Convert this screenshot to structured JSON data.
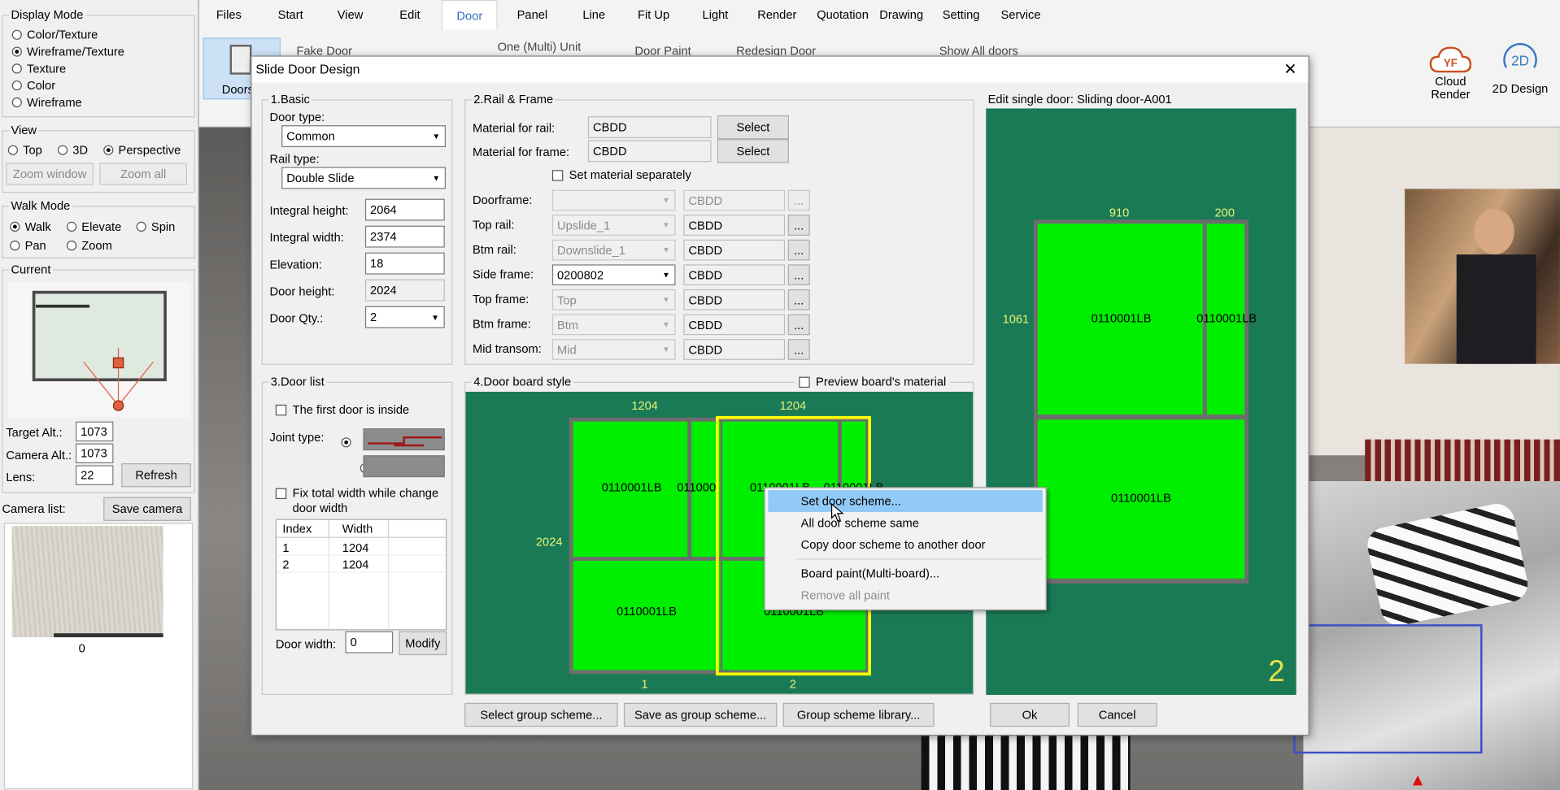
{
  "left_panel": {
    "display_mode": {
      "title": "Display Mode",
      "options": [
        "Color/Texture",
        "Wireframe/Texture",
        "Texture",
        "Color",
        "Wireframe"
      ],
      "selected": "Wireframe/Texture"
    },
    "view": {
      "title": "View",
      "options": [
        "Top",
        "3D",
        "Perspective"
      ],
      "selected": "Perspective",
      "zoom_window": "Zoom window",
      "zoom_all": "Zoom all"
    },
    "walk_mode": {
      "title": "Walk Mode",
      "options": [
        "Walk",
        "Elevate",
        "Spin",
        "Pan",
        "Zoom"
      ],
      "selected": "Walk"
    },
    "current": {
      "title": "Current",
      "target_alt_label": "Target Alt.:",
      "target_alt": "1073",
      "camera_alt_label": "Camera Alt.:",
      "camera_alt": "1073",
      "lens_label": "Lens:",
      "lens": "22",
      "refresh": "Refresh"
    },
    "camera_list": {
      "label": "Camera list:",
      "save_camera": "Save camera",
      "thumb_caption": "0"
    }
  },
  "ribbon": {
    "menus": [
      "Files",
      "Start",
      "View",
      "Edit",
      "Door",
      "Panel",
      "Line",
      "Fit Up",
      "Light",
      "Render",
      "Quotation",
      "Drawing",
      "Setting",
      "Service"
    ],
    "active_menu": "Door",
    "tools": {
      "doors": "Doors",
      "fake_door": "Fake Door",
      "one_multi_unit": "One (Multi) Unit",
      "door_paint": "Door Paint",
      "redesign_door": "Redesign Door",
      "show_all_doors": "Show All doors"
    },
    "cloud_render": {
      "line1": "Cloud",
      "line2": "Render",
      "logo_text": "YF"
    },
    "design_2d": {
      "label": "2D Design",
      "logo_text": "2D"
    }
  },
  "dialog": {
    "title": "Slide Door Design",
    "close_glyph": "✕",
    "basic": {
      "title": "1.Basic",
      "door_type_label": "Door type:",
      "door_type": "Common",
      "rail_type_label": "Rail type:",
      "rail_type": "Double Slide",
      "integral_height_label": "Integral height:",
      "integral_height": "2064",
      "integral_width_label": "Integral width:",
      "integral_width": "2374",
      "elevation_label": "Elevation:",
      "elevation": "18",
      "door_height_label": "Door height:",
      "door_height": "2024",
      "door_qty_label": "Door Qty.:",
      "door_qty": "2"
    },
    "rail_frame": {
      "title": "2.Rail & Frame",
      "material_rail_label": "Material for rail:",
      "material_rail": "CBDD",
      "material_frame_label": "Material for frame:",
      "material_frame": "CBDD",
      "select_label": "Select",
      "set_separately_label": "Set material separately",
      "rows": [
        {
          "label": "Doorframe:",
          "value": "",
          "material": "CBDD",
          "enabled": false,
          "material_enabled": false
        },
        {
          "label": "Top rail:",
          "value": "Upslide_1",
          "material": "CBDD",
          "enabled": false,
          "material_enabled": true
        },
        {
          "label": "Btm rail:",
          "value": "Downslide_1",
          "material": "CBDD",
          "enabled": false,
          "material_enabled": true
        },
        {
          "label": "Side frame:",
          "value": "0200802",
          "material": "CBDD",
          "enabled": true,
          "material_enabled": true
        },
        {
          "label": "Top frame:",
          "value": "Top",
          "material": "CBDD",
          "enabled": false,
          "material_enabled": true
        },
        {
          "label": "Btm frame:",
          "value": "Btm",
          "material": "CBDD",
          "enabled": false,
          "material_enabled": true
        },
        {
          "label": "Mid transom:",
          "value": "Mid",
          "material": "CBDD",
          "enabled": false,
          "material_enabled": true
        }
      ],
      "ellipsis": "..."
    },
    "door_list": {
      "title": "3.Door list",
      "first_door_inside": "The first door is inside",
      "joint_type_label": "Joint type:",
      "fix_total_width": "Fix total width while change door width",
      "columns": [
        "Index",
        "Width"
      ],
      "rows": [
        {
          "index": "1",
          "width": "1204"
        },
        {
          "index": "2",
          "width": "1204"
        }
      ],
      "door_width_label": "Door width:",
      "door_width": "0",
      "modify": "Modify"
    },
    "board_style": {
      "title": "4.Door board style",
      "preview_label": "Preview board's material",
      "door1_width": "1204",
      "door2_width": "1204",
      "height": "2024",
      "board_code": "0110001LB",
      "board_code_partial": "011000",
      "board_code_tail": "0110001LB",
      "index1": "1",
      "index2": "2"
    },
    "edit_single": {
      "title_prefix": "Edit single door:",
      "title_value": "Sliding door-A001",
      "left_width": "910",
      "right_width": "200",
      "top_height": "1061",
      "board_code": "0110001LB",
      "board_code_right": "0110001LB",
      "door_number": "2"
    },
    "bottom": {
      "select_group": "Select group scheme...",
      "save_group": "Save as group scheme...",
      "group_library": "Group scheme library...",
      "ok": "Ok",
      "cancel": "Cancel"
    }
  },
  "context_menu": {
    "items": [
      {
        "label": "Set door scheme...",
        "highlighted": true,
        "enabled": true
      },
      {
        "label": "All door scheme same",
        "highlighted": false,
        "enabled": true
      },
      {
        "label": "Copy door scheme to another door",
        "highlighted": false,
        "enabled": true
      },
      {
        "label": "Board paint(Multi-board)...",
        "highlighted": false,
        "enabled": true
      },
      {
        "label": "Remove all paint",
        "highlighted": false,
        "enabled": false
      }
    ]
  },
  "colors": {
    "board_green": "#00ee00",
    "panel_green": "#1a7a55",
    "selection_yellow": "#ffff00",
    "dimension_yellow": "#e6f07a",
    "menu_highlight": "#91c9f7",
    "accent_blue": "#2f6ebe"
  }
}
